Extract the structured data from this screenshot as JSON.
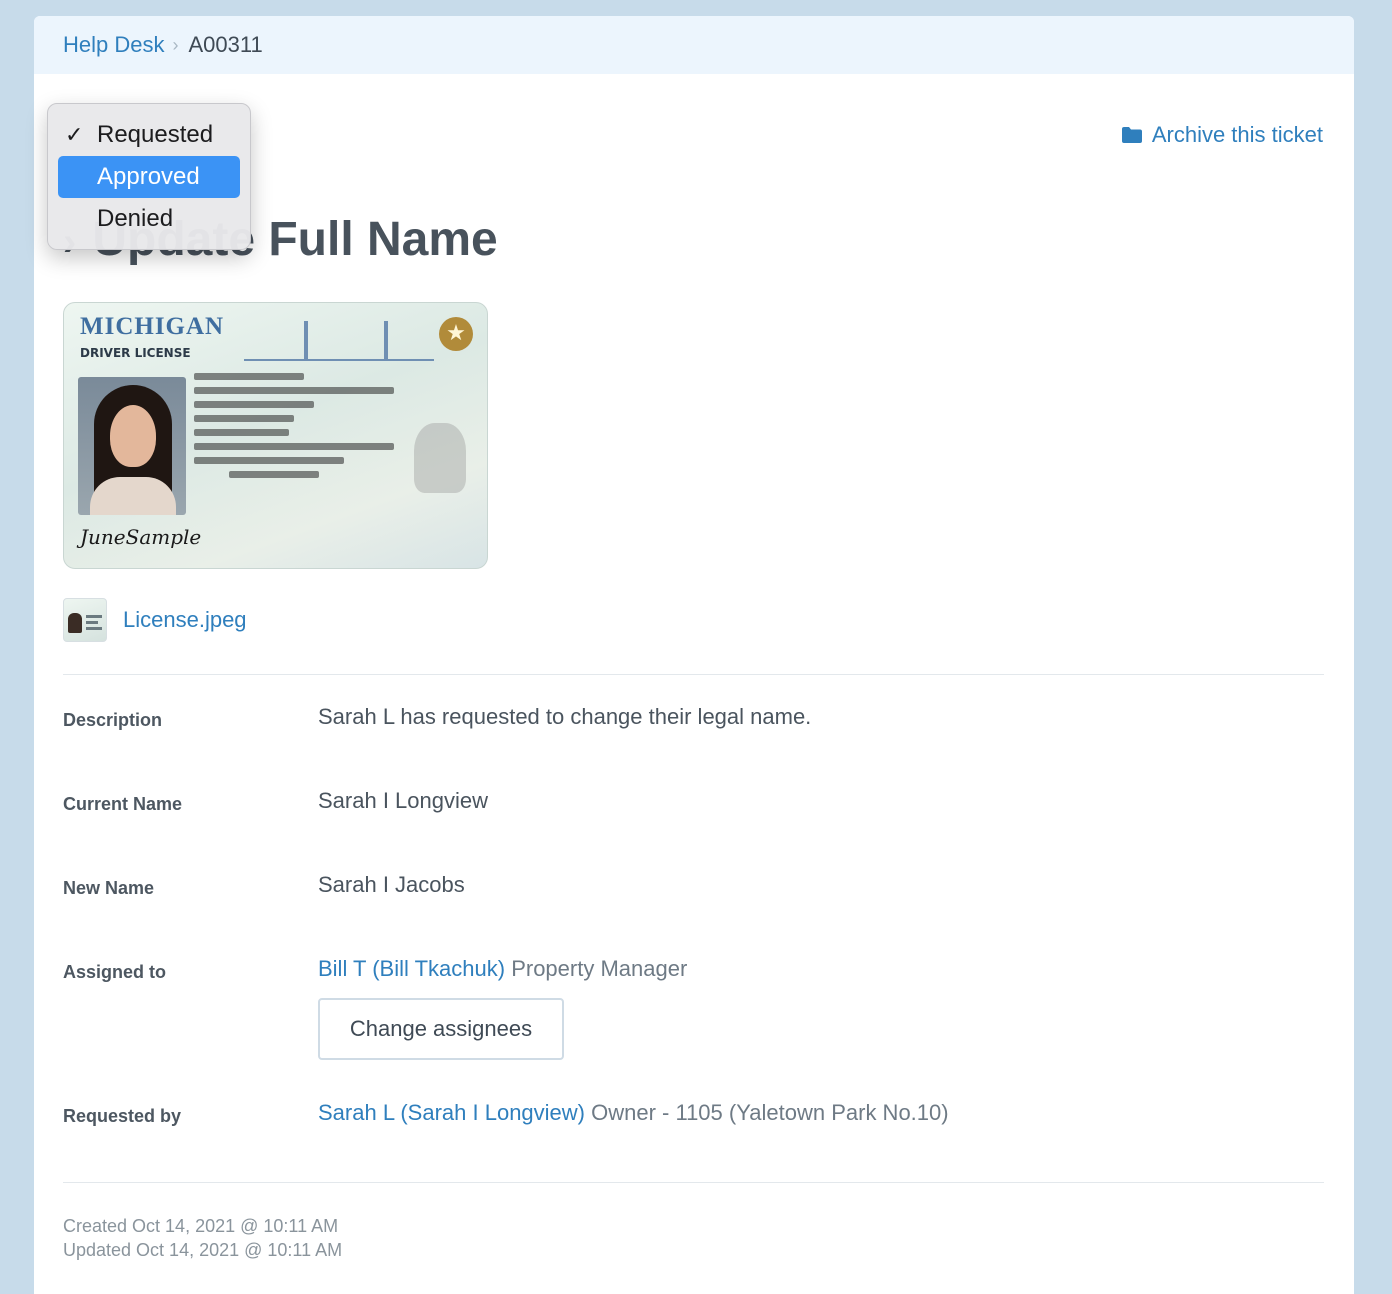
{
  "breadcrumb": {
    "root": "Help Desk",
    "separator": "›",
    "current": "A00311"
  },
  "actions": {
    "archive_label": "Archive this ticket",
    "archive_icon": "folder-icon"
  },
  "ticket": {
    "title": "Update Full Name",
    "title_prefix_icon": "chevron-right-icon"
  },
  "license_image": {
    "state": "MICHIGAN",
    "card_type": "DRIVER LICENSE",
    "signature": "JuneSample"
  },
  "attachment": {
    "filename": "License.jpeg"
  },
  "details": {
    "description": {
      "label": "Description",
      "value": "Sarah L has requested to change their legal name."
    },
    "current_name": {
      "label": "Current Name",
      "value": "Sarah I Longview"
    },
    "new_name": {
      "label": "New Name",
      "value": "Sarah I Jacobs"
    },
    "assigned_to": {
      "label": "Assigned to",
      "person": "Bill T (Bill Tkachuk)",
      "role": "Property Manager",
      "button_label": "Change assignees"
    },
    "requested_by": {
      "label": "Requested by",
      "person": "Sarah L (Sarah I Longview)",
      "role": "Owner - 1105 (Yaletown Park No.10)"
    }
  },
  "meta": {
    "created": "Created Oct 14, 2021 @ 10:11 AM",
    "updated": "Updated Oct 14, 2021 @ 10:11 AM"
  },
  "status_dropdown": {
    "options": [
      "Requested",
      "Approved",
      "Denied"
    ],
    "checked": "Requested",
    "highlighted": "Approved",
    "check_glyph": "✓"
  },
  "colors": {
    "link": "#2f7fbd",
    "highlight": "#3b93f5",
    "background": "#c7dbea",
    "breadcrumb_bg": "#ecf5fd"
  }
}
